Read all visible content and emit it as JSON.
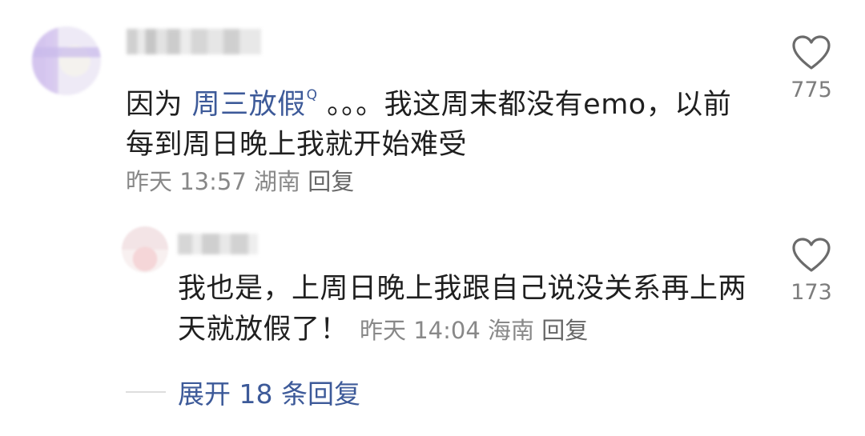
{
  "comment": {
    "text_before": "因为 ",
    "search_term": "周三放假",
    "search_icon": "search-superscript-icon",
    "search_glyph": "Q",
    "text_after": " 。。。我这周末都没有emo，以前每到周日晚上我就开始难受",
    "time": "昨天 13:57",
    "location": "湖南",
    "reply_label": "回复",
    "like_icon": "heart-outline-icon",
    "like_count": "775"
  },
  "reply": {
    "text": "我也是，上周日晚上我跟自己说没关系再上两天就放假了！",
    "time": "昨天 14:04",
    "location": "海南",
    "reply_label": "回复",
    "like_icon": "heart-outline-icon",
    "like_count": "173"
  },
  "expand": {
    "label": "展开 18 条回复"
  },
  "colors": {
    "link": "#3d5a99",
    "meta": "#888888",
    "text": "#1f1f1f"
  }
}
